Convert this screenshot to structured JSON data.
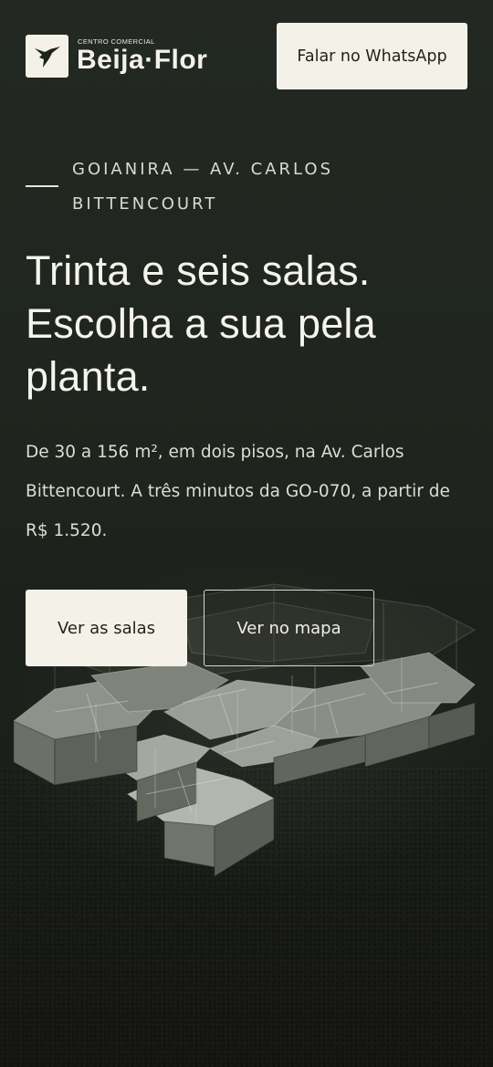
{
  "brand": {
    "tagline": "CENTRO COMERCIAL",
    "name": "Beija·Flor"
  },
  "header": {
    "whatsapp_label": "Falar no WhatsApp"
  },
  "hero": {
    "eyebrow": "GOIANIRA — AV. CARLOS BITTENCOURT",
    "headline": "Trinta e seis salas. Escolha a sua pela planta.",
    "lead": "De 30 a 156 m², em dois pisos, na Av. Carlos Bittencourt. A três minutos da GO-070, a partir de R$ 1.520.",
    "primary_cta": "Ver as salas",
    "secondary_cta": "Ver no mapa"
  },
  "colors": {
    "background": "#1d211c",
    "cream": "#f3f1e8"
  },
  "icons": {
    "logo": "hummingbird-icon"
  }
}
